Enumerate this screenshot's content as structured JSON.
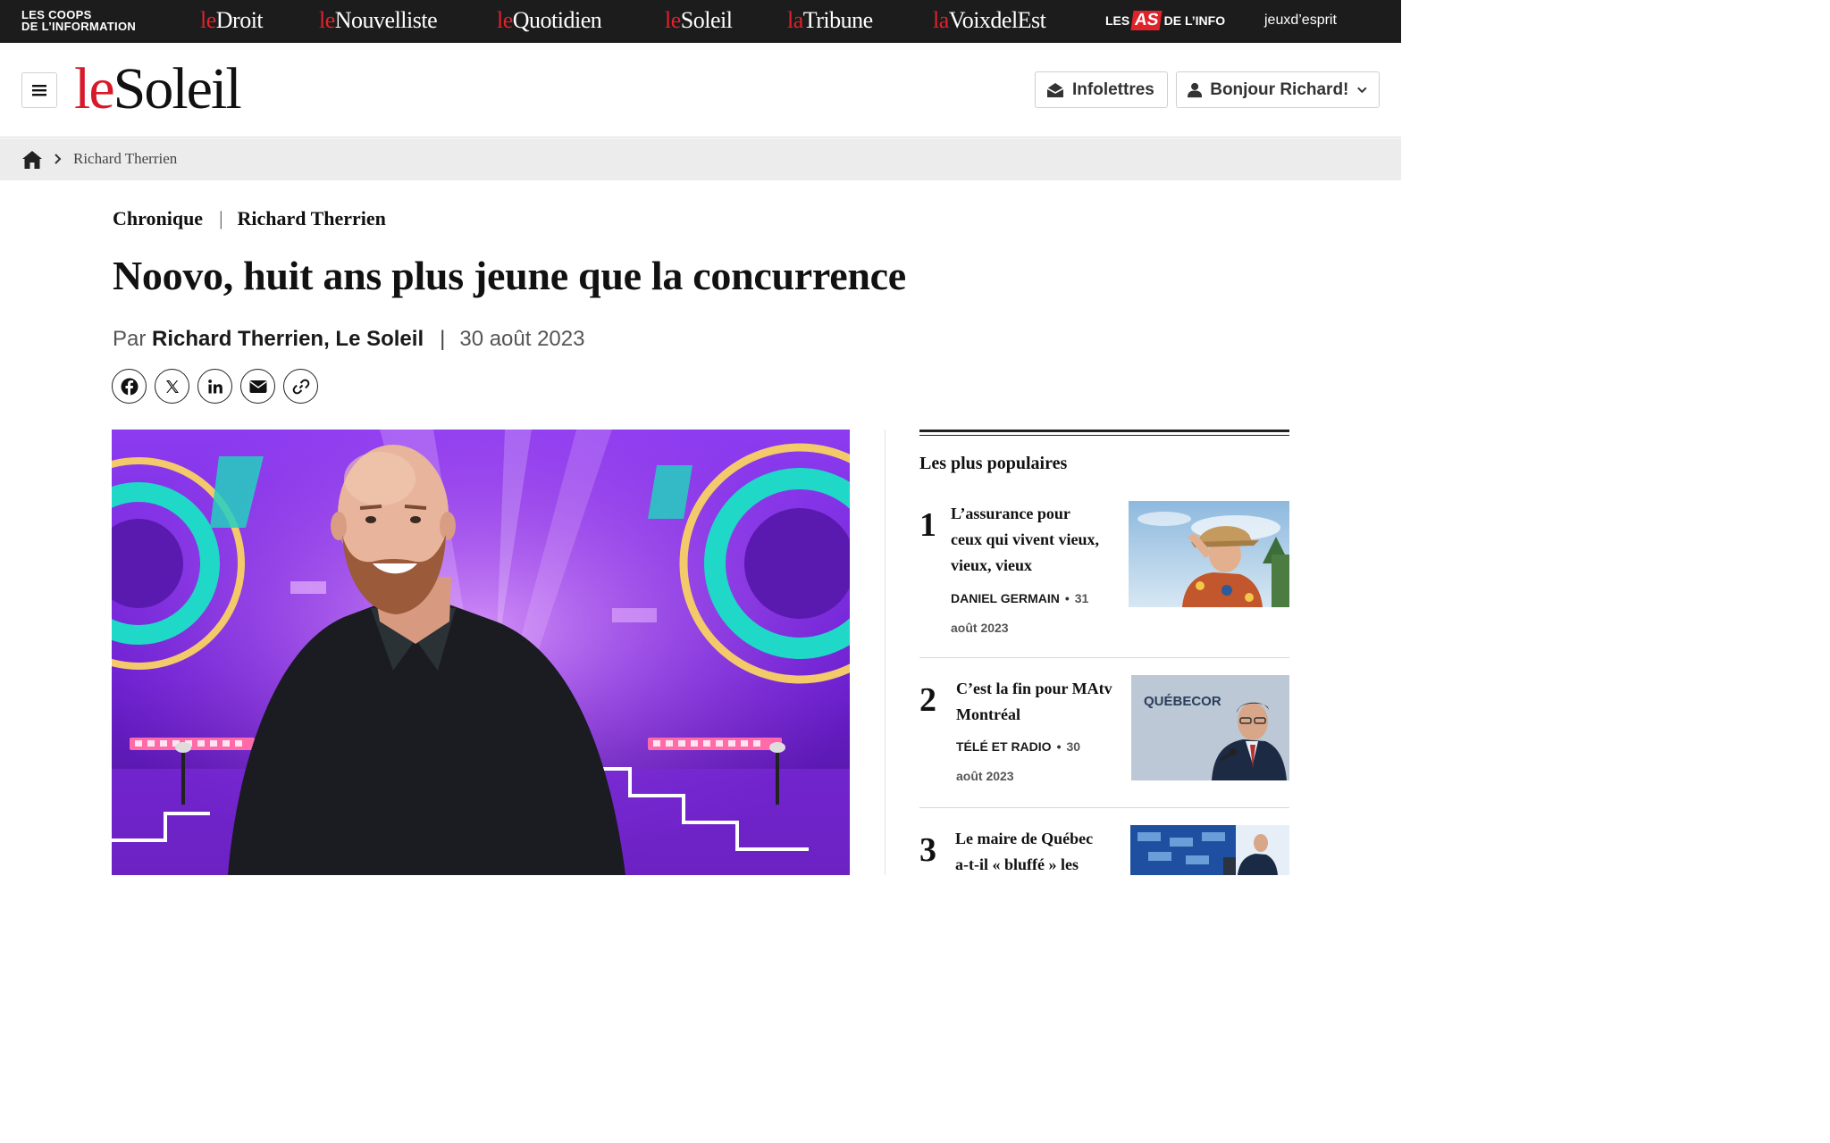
{
  "network": {
    "coops_line1": "LES COOPS",
    "coops_line2": "DE L’INFORMATION",
    "sites": [
      {
        "pre": "le",
        "name": "Droit"
      },
      {
        "pre": "le",
        "name": "Nouvelliste"
      },
      {
        "pre": "le",
        "name": "Quotidien"
      },
      {
        "pre": "le",
        "name": "Soleil"
      },
      {
        "pre": "la",
        "name": "Tribune"
      },
      {
        "pre": "la",
        "name": "VoixdelEst"
      }
    ],
    "as_pre": "LES",
    "as_badge": "AS",
    "as_post": "DE L’INFO",
    "jeux": "jeuxd’esprit"
  },
  "header": {
    "logo_pre": "le",
    "logo_name": "Soleil",
    "newsletters_label": "Infolettres",
    "user_label": "Bonjour Richard!"
  },
  "breadcrumb": {
    "current": "Richard Therrien"
  },
  "article": {
    "section": "Chronique",
    "column": "Richard Therrien",
    "title": "Noovo, huit ans plus jeune que la concurrence",
    "by_prefix": "Par",
    "author": "Richard Therrien, Le Soleil",
    "date": "30 août 2023"
  },
  "sidebar": {
    "title": "Les plus populaires",
    "items": [
      {
        "num": "1",
        "title_lines": [
          "L’assurance pour",
          "ceux qui vivent vieux,",
          "vieux, vieux"
        ],
        "category": "DANIEL GERMAIN",
        "date_part1": "31",
        "date_part2": "août 2023"
      },
      {
        "num": "2",
        "title_lines": [
          "C’est la fin pour MAtv",
          "Montréal"
        ],
        "category": "TÉLÉ ET RADIO",
        "date_part1": "30",
        "date_part2": "août 2023"
      },
      {
        "num": "3",
        "title_lines": [
          "Le maire de Québec",
          "a-t-il « bluffé » les"
        ],
        "category": "",
        "date_part1": "",
        "date_part2": ""
      }
    ],
    "thumb2_text": "QUÉBECOR"
  },
  "colors": {
    "topbar": "#1c1c1c",
    "brand_red": "#d7192a",
    "breadcrumb_bg": "#ececec"
  }
}
